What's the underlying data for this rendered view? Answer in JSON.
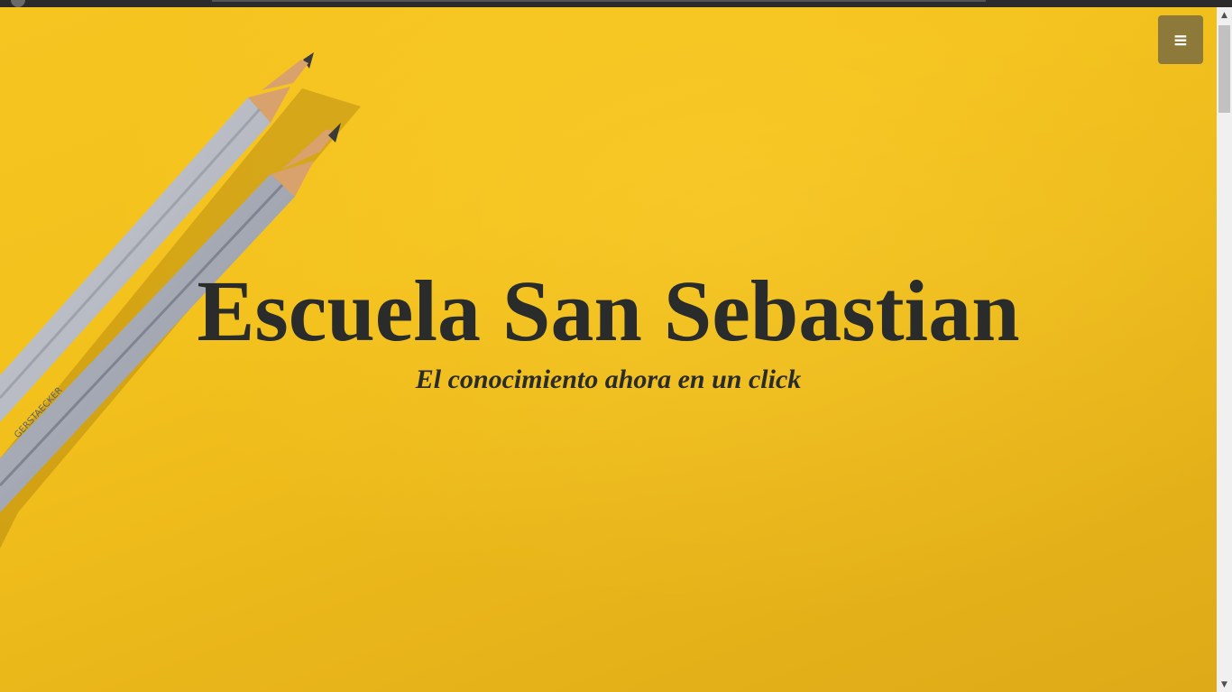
{
  "hero": {
    "title": "Escuela San Sebastian",
    "subtitle": "El conocimiento ahora en un click"
  },
  "menu": {
    "icon": "≡"
  },
  "scrollbar": {
    "up": "▲",
    "down": "▼"
  },
  "colors": {
    "background": "#f3c11c",
    "text": "#2a2b2b",
    "menu_button": "#8d7a3a"
  }
}
